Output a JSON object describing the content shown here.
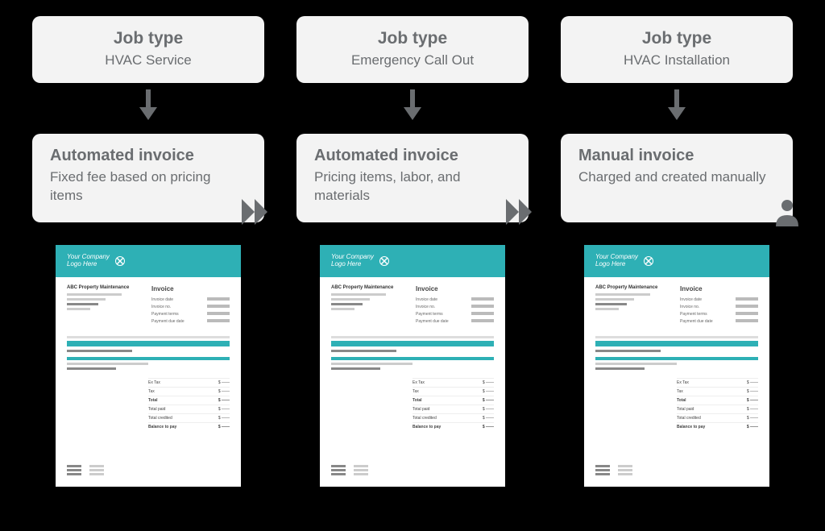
{
  "columns": [
    {
      "jobtype_label": "Job type",
      "jobtype_value": "HVAC Service",
      "invoice_title": "Automated invoice",
      "invoice_desc": "Fixed fee based on pricing items",
      "icon": "fast-forward"
    },
    {
      "jobtype_label": "Job type",
      "jobtype_value": "Emergency Call Out",
      "invoice_title": "Automated invoice",
      "invoice_desc": "Pricing items, labor, and materials",
      "icon": "fast-forward"
    },
    {
      "jobtype_label": "Job type",
      "jobtype_value": "HVAC Installation",
      "invoice_title": "Manual invoice",
      "invoice_desc": "Charged and created manually",
      "icon": "person"
    }
  ],
  "invoice_preview": {
    "logo_text_1": "Your Company",
    "logo_text_2": "Logo Here",
    "company_name": "ABC Property Maintenance",
    "title": "Invoice",
    "fields": {
      "invoice_date": "Invoice date",
      "invoice_no": "Invoice no.",
      "payment_terms": "Payment terms",
      "payment_due_date": "Payment due date"
    },
    "totals": {
      "ex_tax": "Ex Tax",
      "tax": "Tax",
      "total": "Total",
      "total_paid": "Total paid",
      "total_credited": "Total credited",
      "balance_to_pay": "Balance to pay"
    },
    "currency": "$"
  }
}
